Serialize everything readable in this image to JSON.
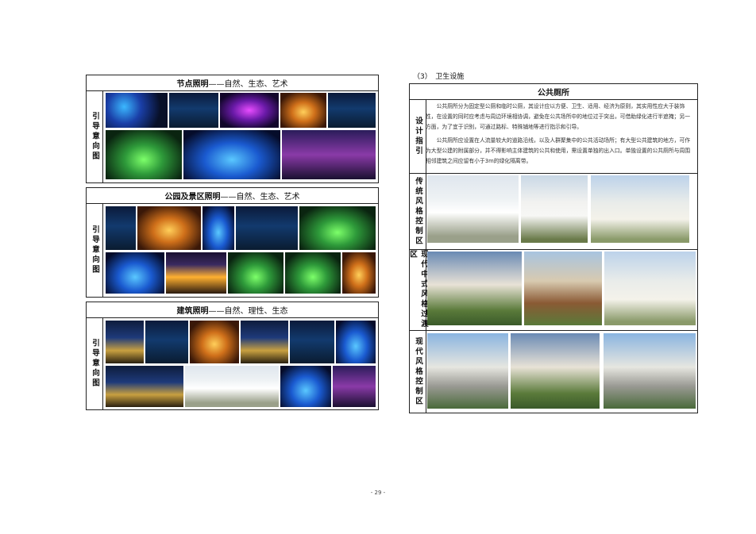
{
  "left": {
    "section1": {
      "title": "节点照明",
      "subtitle": "——自然、生态、艺术",
      "side": "引导意向图"
    },
    "section2": {
      "title": "公园及景区照明",
      "subtitle": "——自然、生态、艺术",
      "side": "引导意向图"
    },
    "section3": {
      "title": "建筑照明",
      "subtitle": "——自然、理性、生态",
      "side": "引导意向图"
    }
  },
  "right": {
    "section_title": "（3）　卫生设施",
    "table_title": "公共厕所",
    "rows": [
      {
        "side": "设计指引"
      },
      {
        "side": "传统风格控制区"
      },
      {
        "side": "现代中式风格过渡区"
      },
      {
        "side": "现代风格控制区"
      }
    ],
    "para1": "公共厕所分为固定型公厕和临时公厕，其设计应以方便、卫生、适用、经济为原则，其实用性应大于装饰性，在设置的同时应考虑与周边环境相协调，避免在公共场所中的地位过于突出，可借助绿化进行半遮掩；另一方面，为了宜于识别，可通过路标、特殊铺地等进行指示和引导。",
    "para2": "公共厕所应设置在人流量较大的道路沿线，以及人群聚集中的公共活动场所；有大型公共建筑的地方，可作为大型公建的附属部分，并不得影响主体建筑的公共和使用，需设置单独的出入口。单独设置的公共厕所与周围相邻建筑之间应留有小于3m的绿化隔离带。"
  },
  "page_number": "- 29 -"
}
